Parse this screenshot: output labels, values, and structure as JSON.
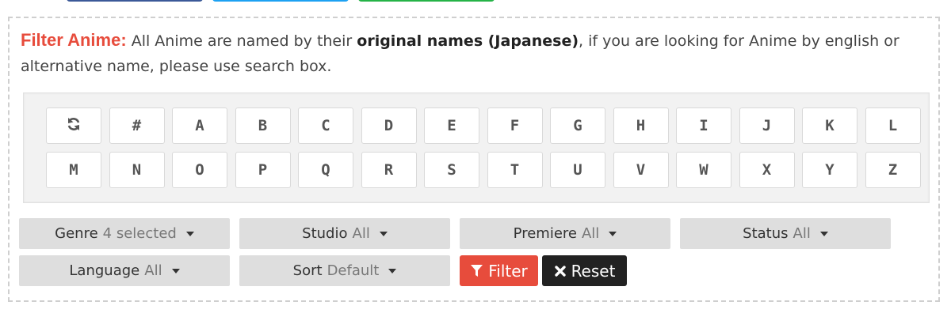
{
  "intro": {
    "title": "Filter Anime:",
    "text_before": " All Anime are named by their ",
    "bold_text": "original names (Japanese)",
    "text_after": ", if you are looking for Anime by english or alternative name, please use search box."
  },
  "letters": {
    "reset_icon": "refresh-icon",
    "row1": [
      "#",
      "A",
      "B",
      "C",
      "D",
      "E",
      "F",
      "G",
      "H",
      "I",
      "J",
      "K",
      "L"
    ],
    "row2": [
      "M",
      "N",
      "O",
      "P",
      "Q",
      "R",
      "S",
      "T",
      "U",
      "V",
      "W",
      "X",
      "Y",
      "Z"
    ]
  },
  "filters": {
    "genre": {
      "label": "Genre",
      "value": "4 selected"
    },
    "studio": {
      "label": "Studio",
      "value": "All"
    },
    "premiere": {
      "label": "Premiere",
      "value": "All"
    },
    "status": {
      "label": "Status",
      "value": "All"
    },
    "language": {
      "label": "Language",
      "value": "All"
    },
    "sort": {
      "label": "Sort",
      "value": "Default"
    }
  },
  "actions": {
    "filter_label": "Filter",
    "reset_label": "Reset",
    "filter_color": "#e74c3c",
    "reset_color": "#222222"
  },
  "colors": {
    "accent": "#e74c3c",
    "share_facebook": "#3b5998",
    "share_twitter": "#1da1f2",
    "share_whatsapp": "#25b347"
  }
}
